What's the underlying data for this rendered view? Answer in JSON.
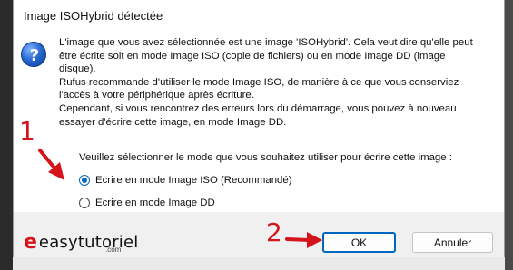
{
  "dialog": {
    "title": "Image ISOHybrid détectée",
    "message_lines": [
      "L'image que vous avez sélectionnée est une image 'ISOHybrid'. Cela veut dire qu'elle peut",
      "être écrite soit en mode Image ISO (copie de fichiers) ou en mode Image DD (image",
      "disque).",
      "Rufus recommande d'utiliser le mode Image ISO, de manière à ce que vous conserviez",
      "l'accès à votre périphérique après écriture.",
      "Cependant, si vous rencontrez des erreurs lors du démarrage, vous pouvez à nouveau",
      "essayer d'écrire cette image, en mode Image DD."
    ],
    "prompt": "Veuillez sélectionner le mode que vous souhaitez utiliser pour écrire cette image :",
    "options": [
      {
        "label": "Ecrire en mode Image ISO (Recommandé)",
        "selected": true
      },
      {
        "label": "Ecrire en mode Image DD",
        "selected": false
      }
    ],
    "buttons": {
      "ok": "OK",
      "cancel": "Annuler"
    },
    "icon": "question-icon"
  },
  "annotations": {
    "step1": "1",
    "step2": "2",
    "arrow_color": "#d4131b"
  },
  "watermark": {
    "logo_letter": "e",
    "name": "easytutoriel",
    "suffix": ".com"
  }
}
